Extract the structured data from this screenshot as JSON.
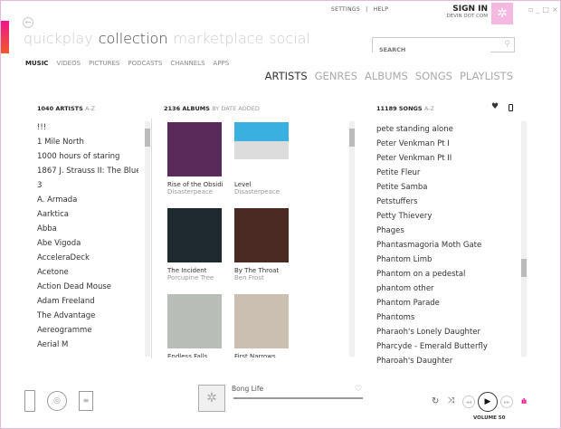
{
  "top": {
    "settings": "SETTINGS",
    "sep": "|",
    "help": "HELP",
    "sign_in": "SIGN IN",
    "user": "DEVIN DOT COM"
  },
  "pivots": [
    {
      "label": "quickplay"
    },
    {
      "label": "collection"
    },
    {
      "label": "marketplace"
    },
    {
      "label": "social"
    }
  ],
  "subnav": [
    {
      "label": "MUSIC"
    },
    {
      "label": "VIDEOS"
    },
    {
      "label": "PICTURES"
    },
    {
      "label": "PODCASTS"
    },
    {
      "label": "CHANNELS"
    },
    {
      "label": "APPS"
    }
  ],
  "search": {
    "placeholder": "SEARCH"
  },
  "views": [
    {
      "label": "ARTISTS"
    },
    {
      "label": "GENRES"
    },
    {
      "label": "ALBUMS"
    },
    {
      "label": "SONGS"
    },
    {
      "label": "PLAYLISTS"
    }
  ],
  "artists": {
    "count": "1040 ARTISTS",
    "sort": "A-Z",
    "items": [
      "!!!",
      "1 Mile North",
      "1000 hours of staring",
      "1867 J. Strauss II: The Blue",
      "3",
      "A. Armada",
      "Aarktica",
      "Abba",
      "Abe Vigoda",
      "AcceleraDeck",
      "Acetone",
      "Action Dead Mouse",
      "Adam Freeland",
      "The Advantage",
      "Aereogramme",
      "Aerial M"
    ]
  },
  "albums": {
    "count": "2136 ALBUMS",
    "sort": "BY DATE ADDED",
    "items": [
      {
        "title": "Rise of the Obsidian",
        "artist": "Disasterpeace",
        "color": "#5a2a5a"
      },
      {
        "title": "Level",
        "artist": "Disasterpeace",
        "color": "#dcdcdc"
      },
      {
        "title": "The Incident",
        "artist": "Porcupine Tree",
        "color": "#1e2a2e"
      },
      {
        "title": "By The Throat",
        "artist": "Ben Frost",
        "color": "#4a2a22"
      },
      {
        "title": "Endless Falls",
        "artist": "",
        "color": "#b8bdb8"
      },
      {
        "title": "First Narrows",
        "artist": "",
        "color": "#cbbfb2"
      }
    ]
  },
  "songs": {
    "count": "11189 SONGS",
    "sort": "A-Z",
    "items": [
      "pete standing alone",
      "Peter Venkman Pt I",
      "Peter Venkman Pt II",
      "Petite Fleur",
      "Petite Samba",
      "Petstuffers",
      "Petty Thievery",
      "Phages",
      "Phantasmagoria Moth Gate",
      "Phantom Limb",
      "Phantom on a pedestal",
      "phantom other",
      "Phantom Parade",
      "Phantoms",
      "Pharaoh's Lonely Daughter",
      "Pharcyde - Emerald Butterfly",
      "Pharoah's Daughter"
    ]
  },
  "player": {
    "now_playing": "Bong Life",
    "volume": "VOLUME 50",
    "progress": 0
  },
  "colors": {
    "accent": "#f0148c"
  }
}
